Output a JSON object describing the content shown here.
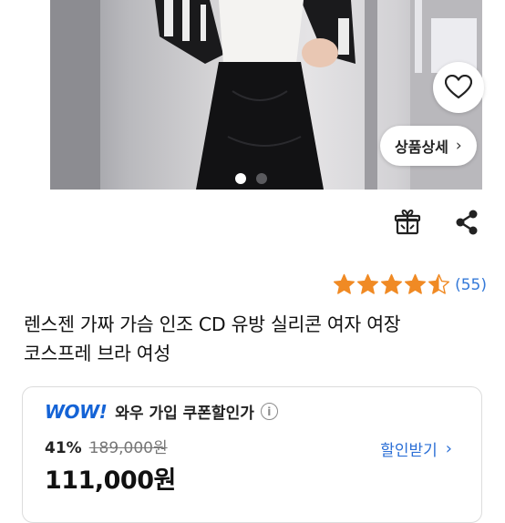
{
  "gallery": {
    "image_count": 2,
    "active_index": 0
  },
  "detail_button": {
    "label": "상품상세",
    "chevron": "›"
  },
  "icons": {
    "wishlist": "heart-icon",
    "gift": "gift-icon",
    "share": "share-icon",
    "info": "info-icon"
  },
  "rating": {
    "stars": 4.5,
    "review_count": "(55)",
    "star_color": "#f08a24"
  },
  "product": {
    "title_line1": "렌스젠 가짜 가슴 인조 CD 유방 실리콘 여자 여장",
    "title_line2": "코스프레 브라 여성"
  },
  "price": {
    "wow_logo": "WOW!",
    "coupon_text": "와우 가입 쿠폰할인가",
    "info_symbol": "i",
    "discount_percent": "41%",
    "original_price": "189,000원",
    "get_discount_label": "할인받기",
    "get_discount_chevron": "›",
    "final_price": "111,000원"
  },
  "colors": {
    "accent_blue": "#2b6fd6",
    "wow_blue": "#1463d6",
    "star_orange": "#f08a24"
  }
}
